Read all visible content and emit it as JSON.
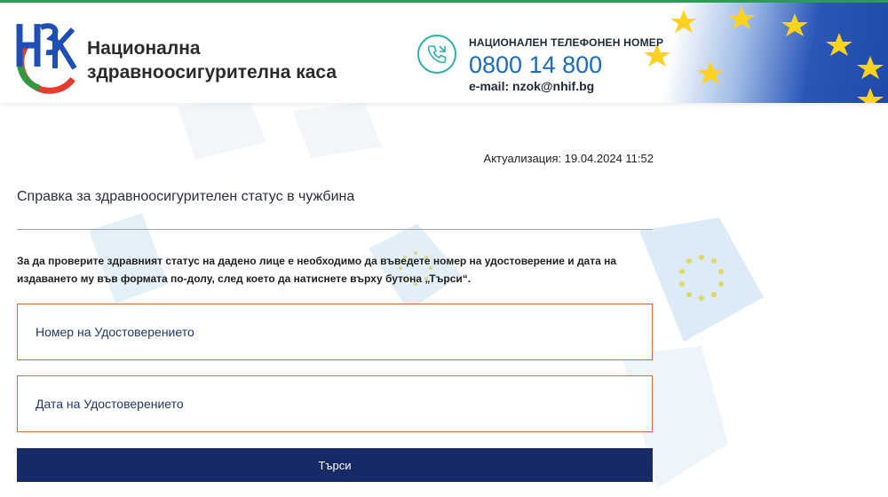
{
  "header": {
    "org_name_line1": "Национална",
    "org_name_line2": "здравноосигурителна каса",
    "phone_title": "НАЦИОНАЛЕН ТЕЛЕФОНЕН НОМЕР",
    "phone_number": "0800 14 800",
    "email": "e-mail: nzok@nhif.bg",
    "icons": {
      "logo": "nzok-logo",
      "phone": "phone-icon",
      "banner": "eu-flag-stars"
    }
  },
  "main": {
    "updated": "Актуализация: 19.04.2024 11:52",
    "title": "Справка за здравноосигурителен статус в чужбина",
    "instructions": "За да проверите здравният статус на дадено лице е необходимо да въведете номер на удостоверение и дата на издаването му във формата по-долу, след което да натиснете върху бутона „Търси“.",
    "certificate_number_placeholder": "Номер на Удостоверението",
    "certificate_date_placeholder": "Дата на Удостоверението",
    "search_button": "Търси"
  },
  "colors": {
    "accent": "#1a6bc0",
    "button": "#172a66",
    "field_border": "#d9663f",
    "teal": "#2ab0a6",
    "eu_blue": "#1f4aa8",
    "star_yellow": "#ffd21f"
  }
}
